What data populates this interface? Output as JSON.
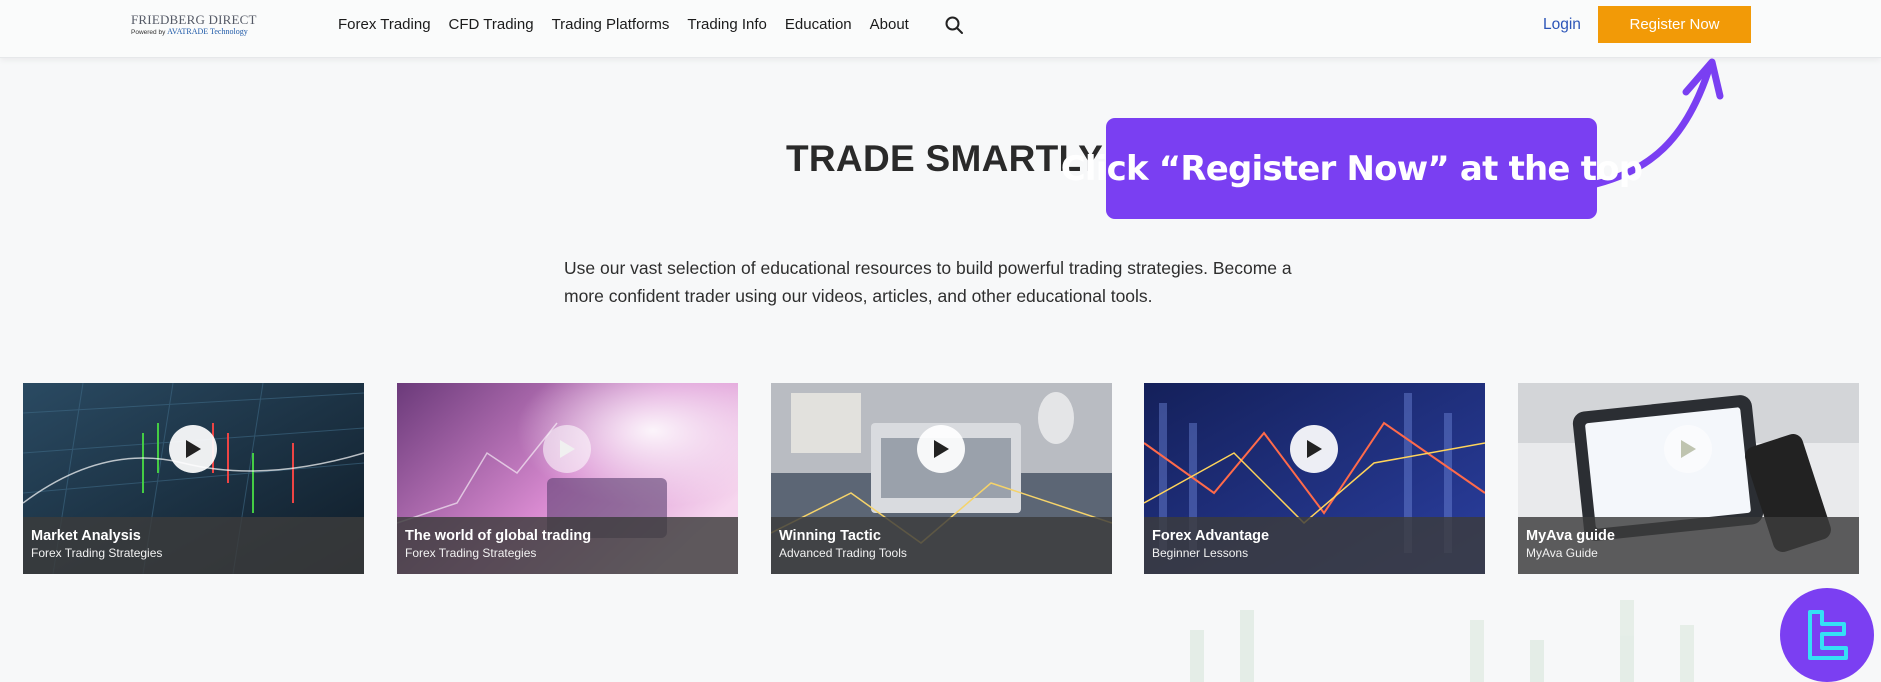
{
  "header": {
    "logo_main": "FRIEDBERG DIRECT",
    "logo_powered": "Powered by",
    "logo_brand": "AVATRADE Technology",
    "nav": [
      "Forex Trading",
      "CFD Trading",
      "Trading Platforms",
      "Trading Info",
      "Education",
      "About"
    ],
    "login": "Login",
    "register": "Register Now"
  },
  "hero": {
    "title": "TRADE SMARTLY",
    "description": "Use our vast selection of educational resources to build powerful trading strategies. Become a more confident trader using our videos, articles, and other educational tools."
  },
  "callout": {
    "text": "Click “Register Now” at the top"
  },
  "cards": [
    {
      "title": "Market Analysis",
      "subtitle": "Forex Trading Strategies"
    },
    {
      "title": "The world of global trading",
      "subtitle": "Forex Trading Strategies"
    },
    {
      "title": "Winning Tactic",
      "subtitle": "Advanced Trading Tools"
    },
    {
      "title": "Forex Advantage",
      "subtitle": "Beginner Lessons"
    },
    {
      "title": "MyAva guide",
      "subtitle": "MyAva Guide"
    }
  ],
  "colors": {
    "register_bg": "#f29a07",
    "callout_bg": "#7a3ff2",
    "login_text": "#2c55b8"
  },
  "icons": {
    "search": "search-icon",
    "play": "play-icon",
    "arrow": "curved-arrow-icon",
    "badge": "tradingfinder-logo-icon"
  }
}
